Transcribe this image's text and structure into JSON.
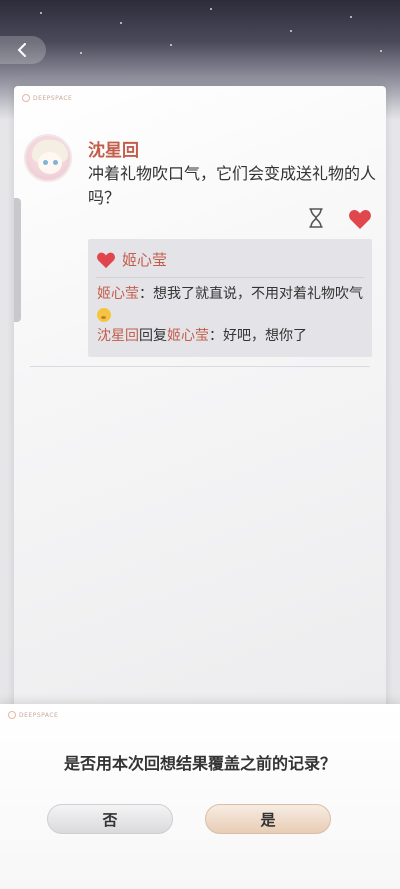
{
  "header": {
    "back_icon": "chevron-left-icon"
  },
  "post": {
    "logo_text": "DEEPSPACE",
    "author": "沈星回",
    "content": "冲着礼物吹口气，它们会变成送礼物的人吗？",
    "icons": {
      "hourglass": "hourglass-icon",
      "like": "heart-icon"
    },
    "like_color": "#e0474c",
    "likes": {
      "names": "姬心莹"
    },
    "comments": [
      {
        "user": "姬心莹",
        "separator": "：",
        "text": "想我了就直说，不用对着礼物吹气"
      },
      {
        "user": "沈星回",
        "reply_word": "回复",
        "target": "姬心莹",
        "separator": "：",
        "text": "好吧，想你了"
      }
    ]
  },
  "dialog": {
    "logo_text": "DEEPSPACE",
    "question": "是否用本次回想结果覆盖之前的记录？",
    "no_label": "否",
    "yes_label": "是"
  },
  "colors": {
    "name_accent": "#c25e4c",
    "heart": "#e0474c"
  }
}
